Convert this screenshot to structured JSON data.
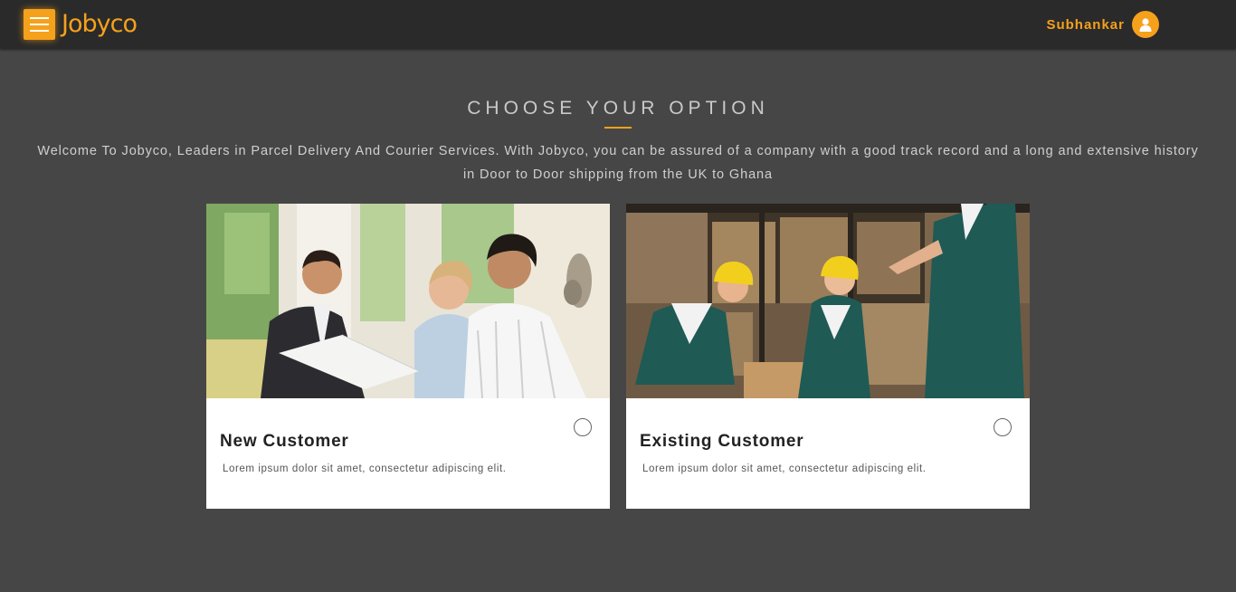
{
  "header": {
    "logo_text": "Jobyco",
    "user_name": "Subhankar",
    "accent_color": "#f5a11c"
  },
  "main": {
    "title": "CHOOSE YOUR OPTION",
    "intro": "Welcome To Jobyco, Leaders in Parcel Delivery And Courier Services. With Jobyco, you can be assured of a company with a good track record and a long and extensive history in Door to Door shipping from the UK to Ghana",
    "options": [
      {
        "title": "New Customer",
        "description": "Lorem ipsum dolor sit amet, consectetur adipiscing elit.",
        "image": "business-meeting-photo",
        "selected": false
      },
      {
        "title": "Existing Customer",
        "description": "Lorem ipsum dolor sit amet, consectetur adipiscing elit.",
        "image": "warehouse-workers-photo",
        "selected": false
      }
    ]
  }
}
